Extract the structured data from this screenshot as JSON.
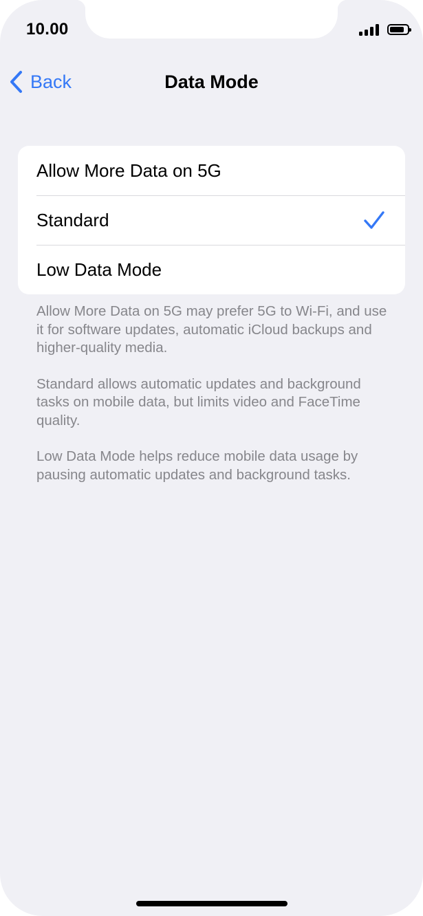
{
  "status_bar": {
    "time": "10.00",
    "signal_icon": "signal-bars-icon",
    "battery_icon": "battery-icon",
    "battery_level": 0.85
  },
  "nav": {
    "back_label": "Back",
    "back_icon": "chevron-left-icon",
    "title": "Data Mode"
  },
  "options": {
    "items": [
      {
        "label": "Allow More Data on 5G",
        "selected": false
      },
      {
        "label": "Standard",
        "selected": true
      },
      {
        "label": "Low Data Mode",
        "selected": false
      }
    ],
    "selected_icon": "checkmark-icon"
  },
  "footer": {
    "notes": [
      "Allow More Data on 5G may prefer 5G to Wi-Fi, and use it for software updates, automatic iCloud backups and higher-quality media.",
      "Standard allows automatic updates and background tasks on mobile data, but limits video and FaceTime quality.",
      "Low Data Mode helps reduce mobile data usage by pausing automatic updates and background tasks."
    ]
  },
  "colors": {
    "accent": "#3478f6",
    "background": "#f0f0f5",
    "footer_text": "#86868b"
  }
}
